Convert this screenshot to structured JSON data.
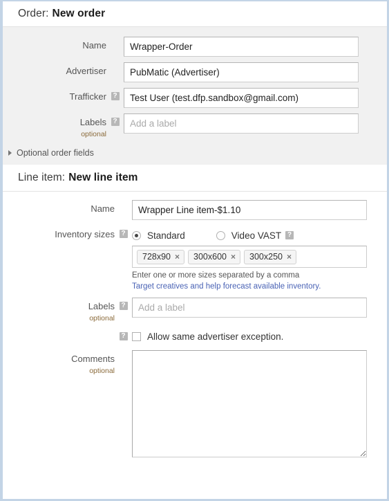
{
  "order_section": {
    "header_prefix": "Order:",
    "header_title": "New order",
    "fields": {
      "name": {
        "label": "Name",
        "value": "Wrapper-Order",
        "placeholder": ""
      },
      "advertiser": {
        "label": "Advertiser",
        "value": "PubMatic (Advertiser)",
        "placeholder": ""
      },
      "trafficker": {
        "label": "Trafficker",
        "value": "Test User (test.dfp.sandbox@gmail.com)",
        "placeholder": "",
        "help": "?"
      },
      "labels": {
        "label": "Labels",
        "optional": "optional",
        "value": "",
        "placeholder": "Add a label",
        "help": "?"
      }
    },
    "optional_fields_toggle": "Optional order fields"
  },
  "line_item_section": {
    "header_prefix": "Line item:",
    "header_title": "New line item",
    "fields": {
      "name": {
        "label": "Name",
        "value": "Wrapper Line item-$1.10",
        "placeholder": ""
      },
      "inventory_sizes": {
        "label": "Inventory sizes",
        "help": "?",
        "options": [
          {
            "label": "Standard",
            "selected": true
          },
          {
            "label": "Video VAST",
            "selected": false,
            "help": "?"
          }
        ],
        "chips": [
          "728x90",
          "300x600",
          "300x250"
        ],
        "chip_remove": "×",
        "hint_line1": "Enter one or more sizes separated by a comma",
        "hint_link": "Target creatives and help forecast available inventory."
      },
      "labels": {
        "label": "Labels",
        "optional": "optional",
        "value": "",
        "placeholder": "Add a label",
        "help": "?"
      },
      "same_advertiser": {
        "help": "?",
        "label": "Allow same advertiser exception.",
        "checked": false
      },
      "comments": {
        "label": "Comments",
        "optional": "optional",
        "value": "",
        "placeholder": ""
      }
    }
  },
  "colors": {
    "page_border": "#c3d4e6",
    "order_bg": "#f1f1f1",
    "link": "#4a63b5",
    "optional_text": "#8a6a3a",
    "help_icon_bg": "#b7b7b7"
  }
}
